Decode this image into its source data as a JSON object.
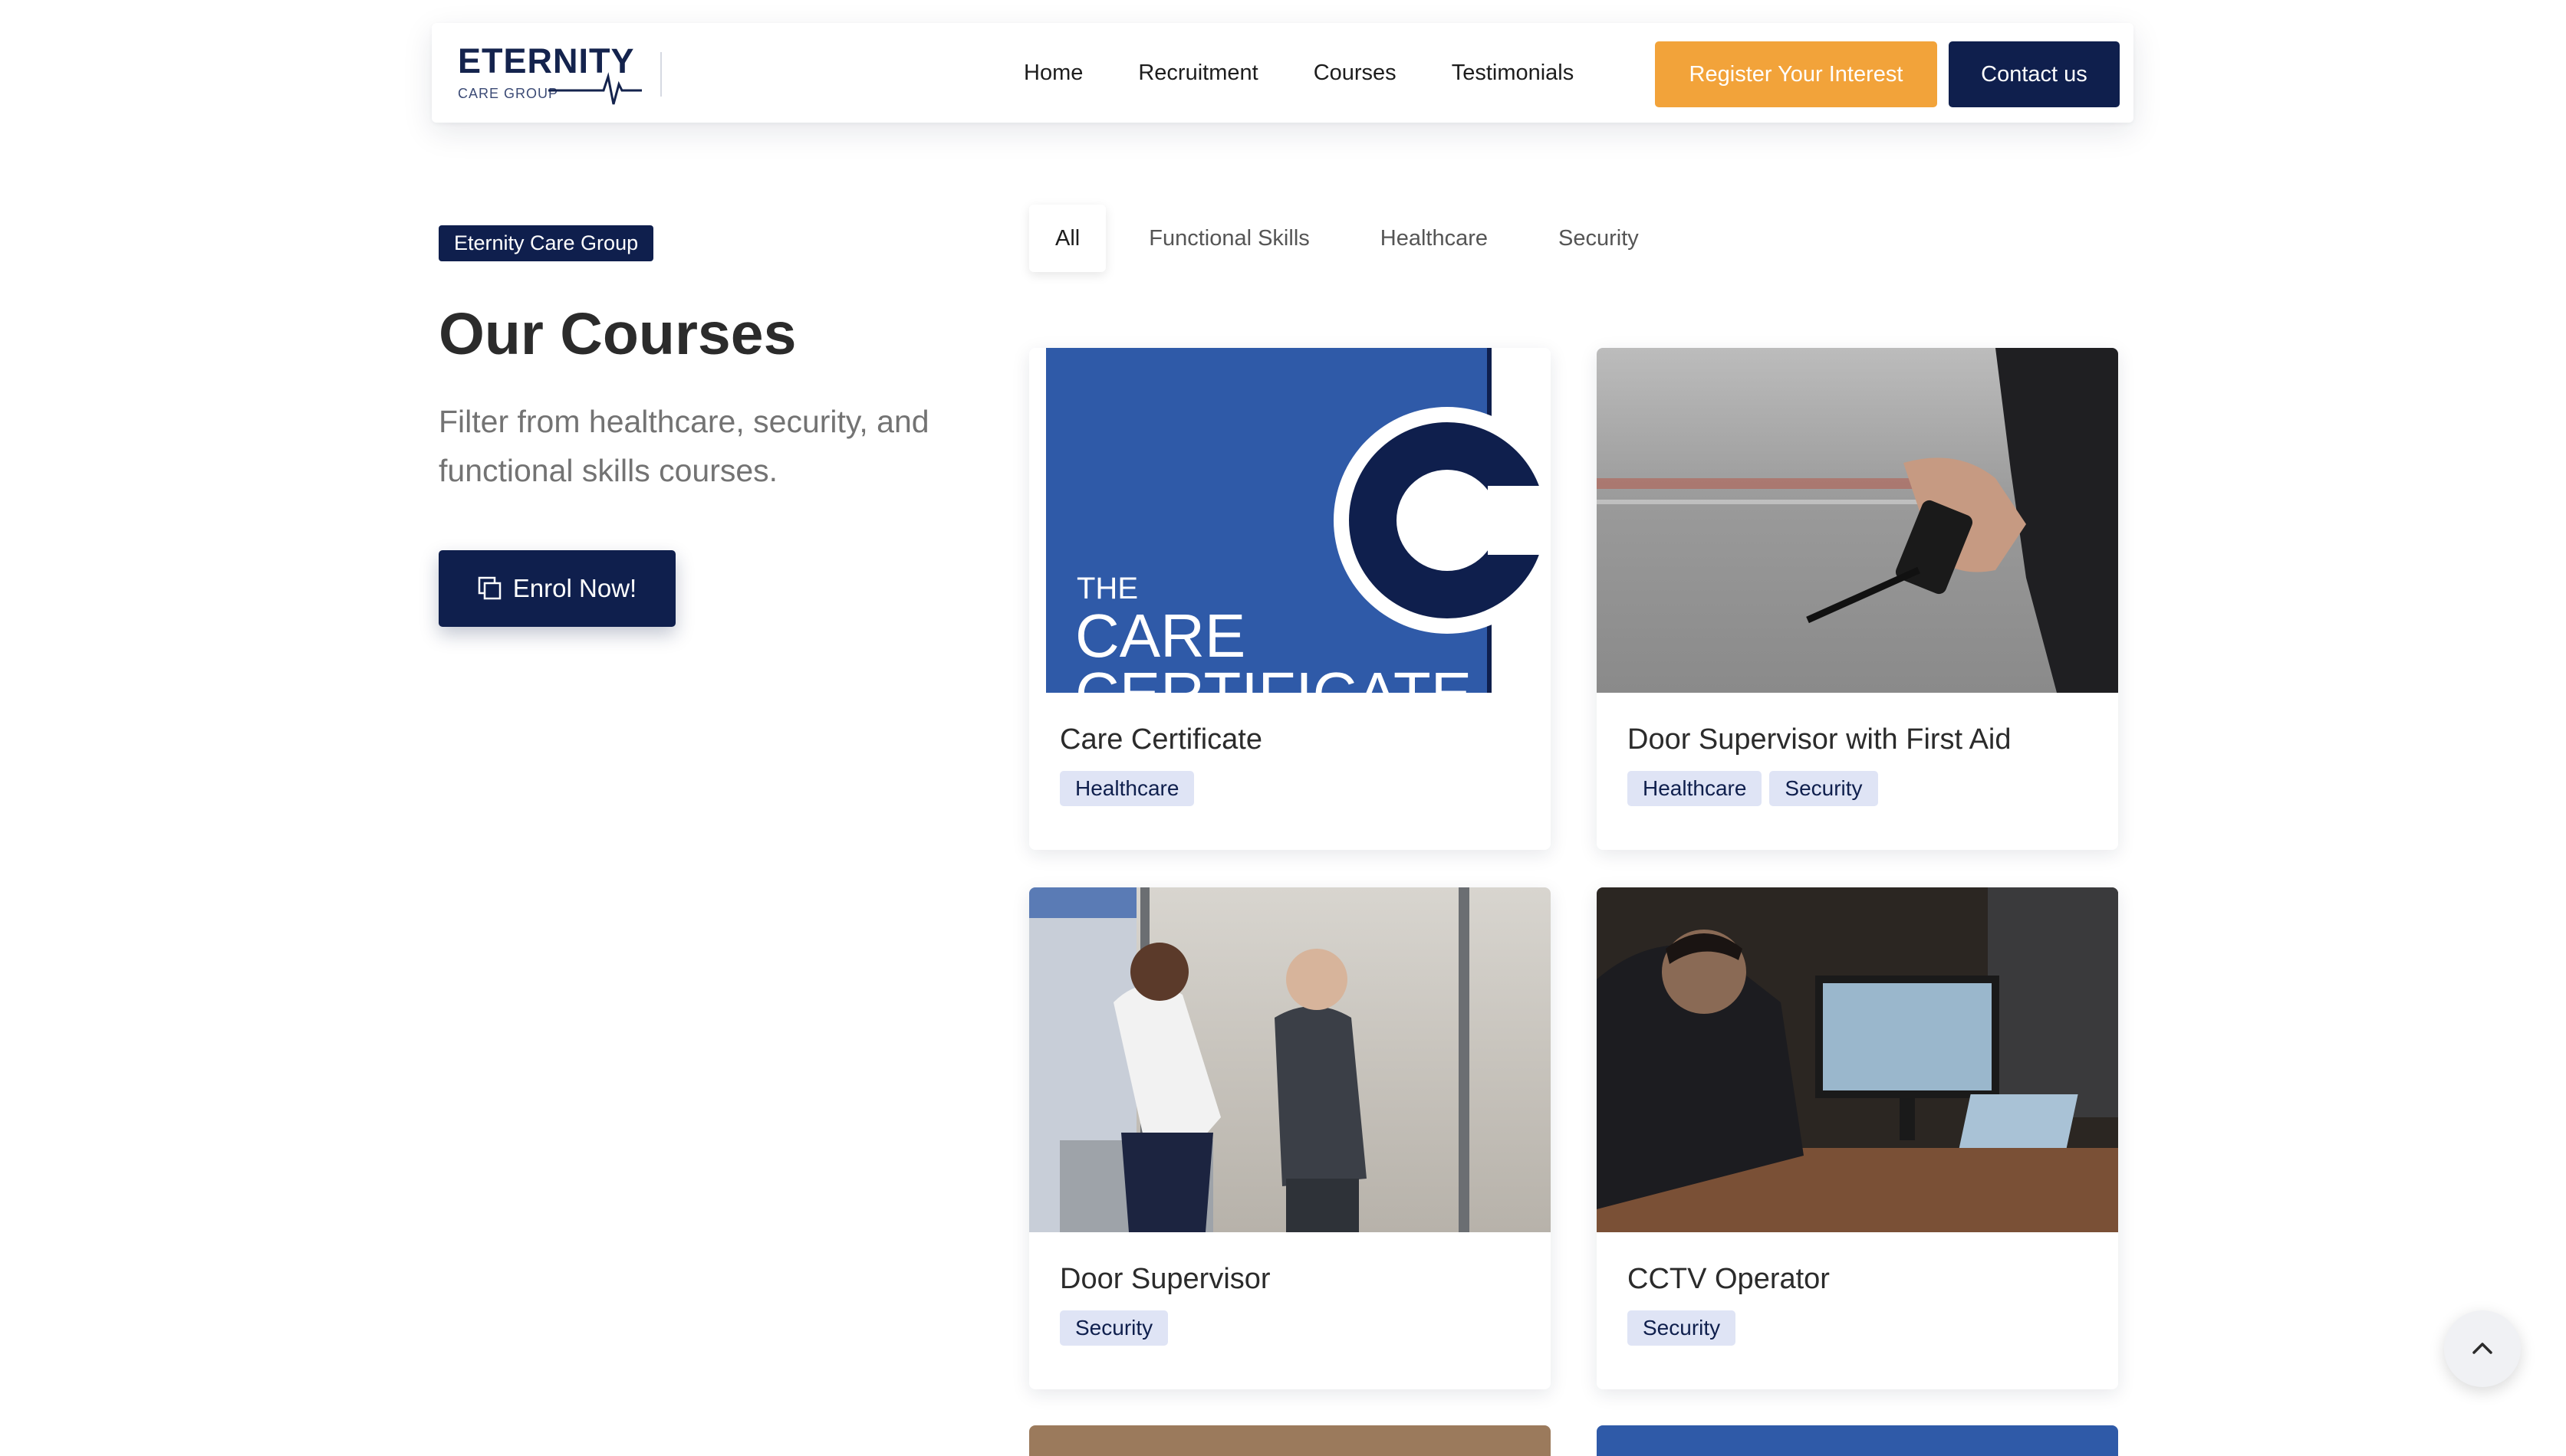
{
  "nav": {
    "logo": {
      "word": "ETERNITY",
      "sub": "CARE GROUP"
    },
    "links": [
      "Home",
      "Recruitment",
      "Courses",
      "Testimonials"
    ],
    "register_label": "Register Your Interest",
    "contact_label": "Contact us"
  },
  "hero": {
    "badge": "Eternity Care Group",
    "title": "Our Courses",
    "subtitle": "Filter from healthcare, security, and functional skills courses.",
    "enrol_label": "Enrol Now!"
  },
  "filters": {
    "tabs": [
      "All",
      "Functional Skills",
      "Healthcare",
      "Security"
    ],
    "active": "All"
  },
  "courses": [
    {
      "title": "Care Certificate",
      "tags": [
        "Healthcare"
      ],
      "image_text": {
        "line1": "THE",
        "line2": "CARE",
        "line3": "CERTIFICATE"
      }
    },
    {
      "title": "Door Supervisor with First Aid",
      "tags": [
        "Healthcare",
        "Security"
      ]
    },
    {
      "title": "Door Supervisor",
      "tags": [
        "Security"
      ]
    },
    {
      "title": "CCTV Operator",
      "tags": [
        "Security"
      ]
    }
  ],
  "colors": {
    "navy": "#0f1f4d",
    "orange": "#f2a33a",
    "tag_bg": "#dfe4f5",
    "care_blue": "#2f5aa8"
  }
}
